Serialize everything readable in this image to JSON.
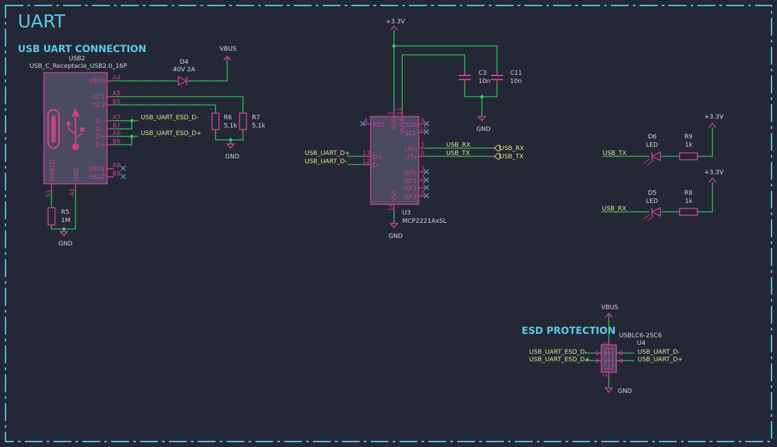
{
  "sheet": {
    "title": "UART",
    "colors": {
      "background": "#242836",
      "frame": "#4fc3e0",
      "wire": "#33c759",
      "symbol": "#c8428e",
      "symbol_fill": "#4b4a63",
      "pin_text": "#c8428e",
      "label_text": "#e6e28a",
      "ref_text": "#d7d7d7",
      "section_title": "#5fc8e8"
    }
  },
  "sections": {
    "usb": "USB UART CONNECTION",
    "esd": "ESD PROTECTION"
  },
  "usb2": {
    "ref": "USB2",
    "value": "USB_C_Receptacle_USB2.0_16P",
    "pins_right": [
      "VBUS",
      "CC1",
      "CC2",
      "D-",
      "D-",
      "D+",
      "D+",
      "SBU1",
      "SBU2"
    ],
    "pin_nums_right": [
      "A4",
      "A5",
      "B5",
      "A7",
      "B7",
      "A6",
      "B6",
      "A8",
      "B8"
    ],
    "pin_shield": "SHIELD",
    "pin_gnd": "GND",
    "pin_num_shield": "S1",
    "pin_num_gnd": "A1"
  },
  "d4": {
    "ref": "D4",
    "value": "40V 2A"
  },
  "r6": {
    "ref": "R6",
    "value": "5,1k"
  },
  "r7": {
    "ref": "R7",
    "value": "5,1k"
  },
  "r5": {
    "ref": "R5",
    "value": "1M"
  },
  "u3": {
    "ref": "U3",
    "value": "MCP2221AxSL",
    "pins": {
      "rst": "RST",
      "dplus": "D+",
      "dminus": "D-",
      "vdd": "VDD",
      "vusb": "VUSB",
      "vss": "VSS",
      "sda": "SDA",
      "scl": "SCL",
      "urx": "URx",
      "utx": "UTx",
      "gp0": "GP0",
      "gp1": "GP1",
      "gp2": "GP2",
      "gp3": "GP3"
    },
    "pin_nums": {
      "rst": "4",
      "dplus": "13",
      "dminus": "12",
      "vdd": "1",
      "vusb": "11",
      "vss": "14",
      "sda": "9",
      "scl": "10",
      "urx": "5",
      "utx": "6",
      "gp0": "2",
      "gp1": "3",
      "gp2": "7",
      "gp3": "8"
    }
  },
  "c3": {
    "ref": "C3",
    "value": "10n"
  },
  "c11": {
    "ref": "C11",
    "value": "10n"
  },
  "d6": {
    "ref": "D6",
    "value": "LED"
  },
  "r9": {
    "ref": "R9",
    "value": "1k"
  },
  "d5": {
    "ref": "D5",
    "value": "LED"
  },
  "r8": {
    "ref": "R8",
    "value": "1k"
  },
  "u4": {
    "ref": "U4",
    "value": "USBLC6-2SC6",
    "pin_nums": [
      "1",
      "3",
      "6",
      "4",
      "5",
      "2"
    ]
  },
  "power": {
    "vbus": "VBUS",
    "v33": "+3.3V",
    "gnd": "GND"
  },
  "nets": {
    "usb_uart_esd_dm": "USB_UART_ESD_D-",
    "usb_uart_esd_dp": "USB_UART_ESD_D+",
    "usb_uart_dp": "USB_UART_D+",
    "usb_uart_dm": "USB_UART_D-",
    "usb_rx": "USB_RX",
    "usb_tx": "USB_TX"
  }
}
